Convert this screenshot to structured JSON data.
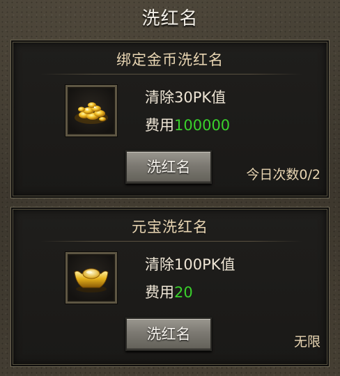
{
  "window": {
    "title": "洗红名"
  },
  "panels": [
    {
      "title": "绑定金币洗红名",
      "icon": "gold-coins-icon",
      "clear_text": "清除30PK值",
      "cost_label": "费用",
      "cost_value": "100000",
      "button_label": "洗红名",
      "limit_text": "今日次数0/2"
    },
    {
      "title": "元宝洗红名",
      "icon": "gold-ingot-icon",
      "clear_text": "清除100PK值",
      "cost_label": "费用",
      "cost_value": "20",
      "button_label": "洗红名",
      "limit_text": "无限"
    }
  ],
  "colors": {
    "cost_value": "#3ad12c",
    "title_text": "#e9d6b3",
    "body_text": "#efe6d6"
  }
}
